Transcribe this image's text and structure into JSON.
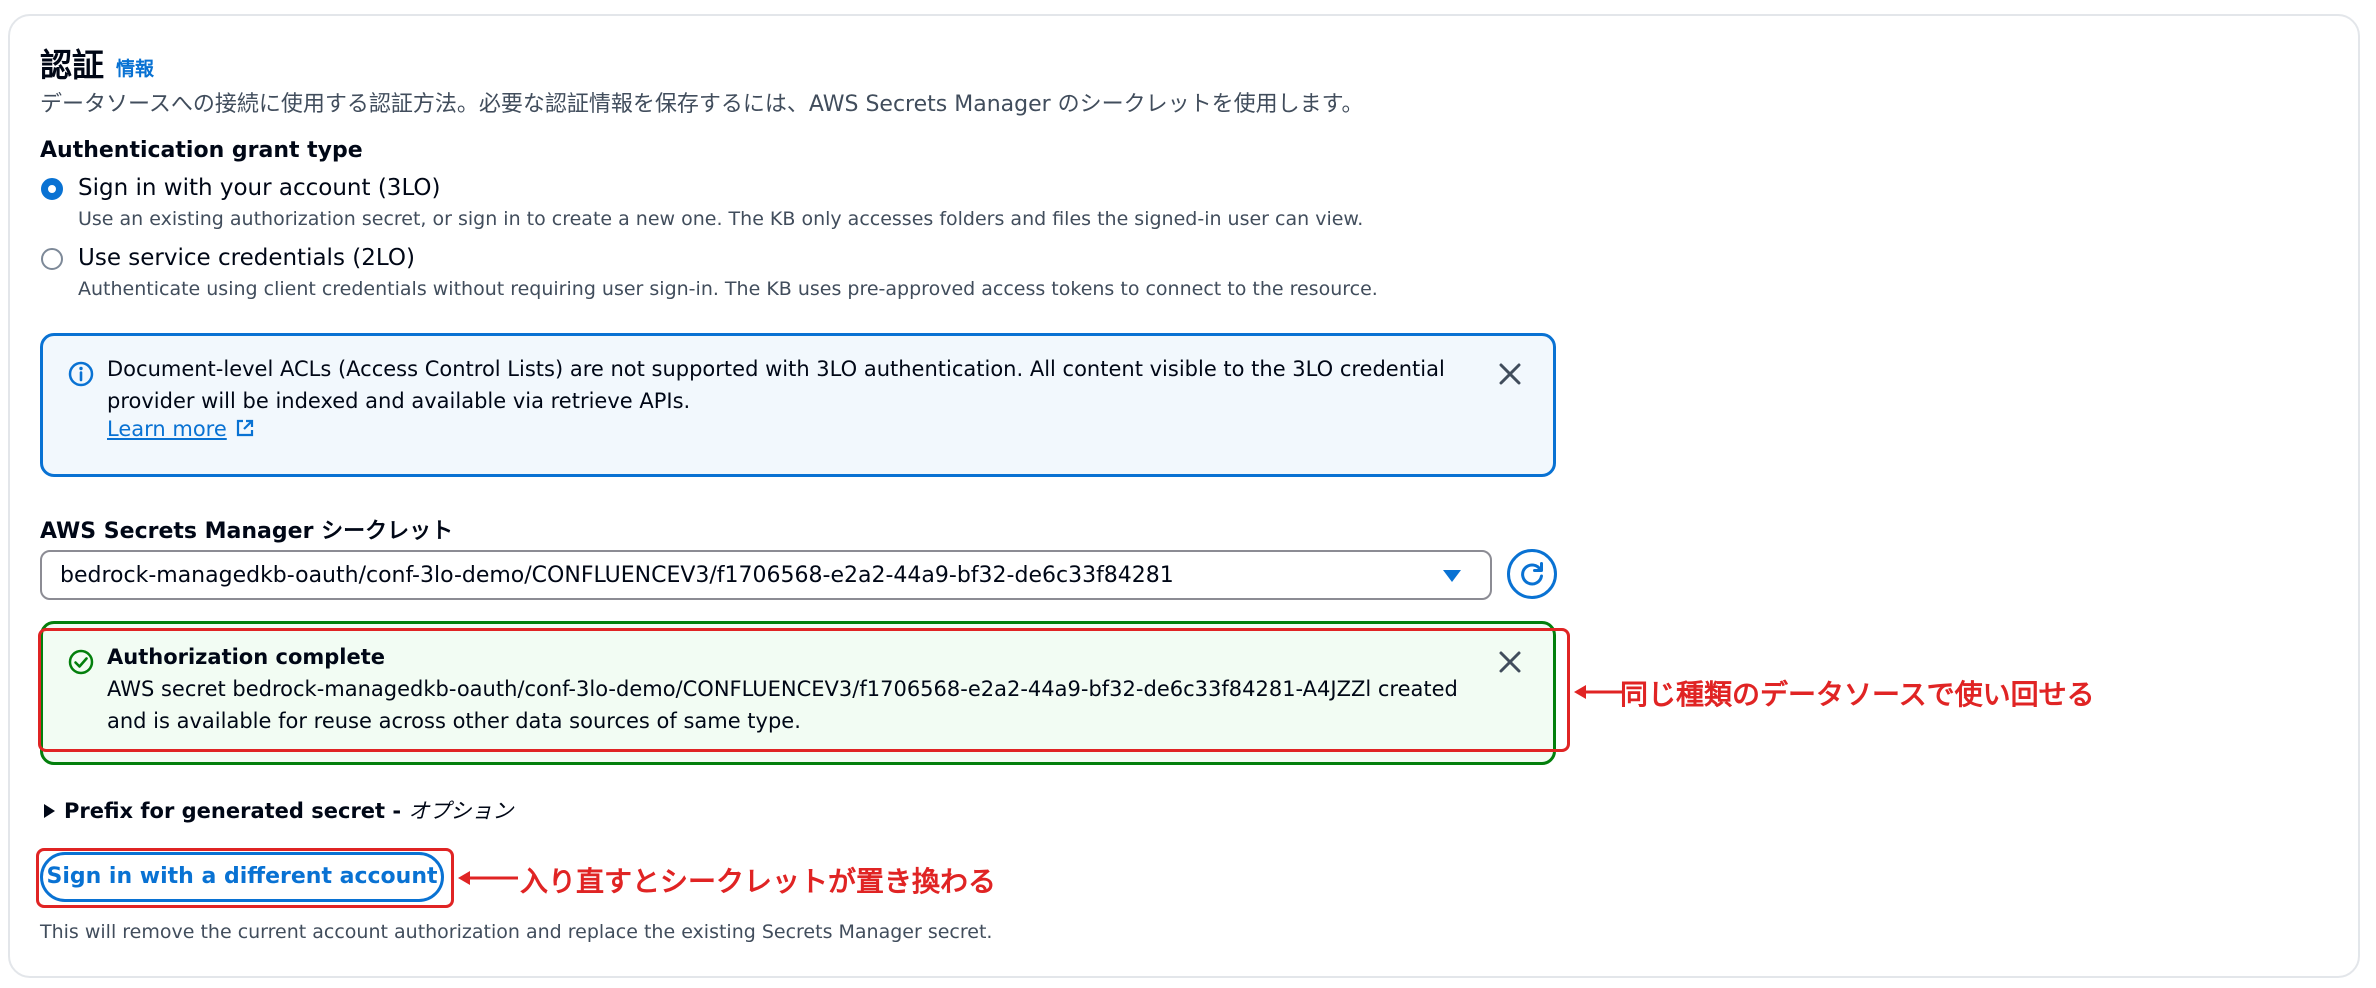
{
  "section": {
    "title": "認証",
    "info_link": "情報",
    "description": "データソースへの接続に使用する認証方法。必要な認証情報を保存するには、AWS Secrets Manager のシークレットを使用します。"
  },
  "grant_type": {
    "label": "Authentication grant type",
    "options": [
      {
        "label": "Sign in with your account (3LO)",
        "description": "Use an existing authorization secret, or sign in to create a new one. The KB only accesses folders and files the signed-in user can view.",
        "selected": true
      },
      {
        "label": "Use service credentials (2LO)",
        "description": "Authenticate using client credentials without requiring user sign-in. The KB uses pre-approved access tokens to connect to the resource.",
        "selected": false
      }
    ]
  },
  "info_alert": {
    "line1": "Document-level ACLs (Access Control Lists) are not supported with 3LO authentication. All content visible to the 3LO credential",
    "line2": "provider will be indexed and available via retrieve APIs.",
    "learn_more": "Learn more",
    "icon": "info-icon"
  },
  "secret_select": {
    "label": "AWS Secrets Manager シークレット",
    "value": "bedrock-managedkb-oauth/conf-3lo-demo/CONFLUENCEV3/f1706568-e2a2-44a9-bf32-de6c33f84281"
  },
  "success_alert": {
    "title": "Authorization complete",
    "line1": "AWS secret bedrock-managedkb-oauth/conf-3lo-demo/CONFLUENCEV3/f1706568-e2a2-44a9-bf32-de6c33f84281-A4JZZl created",
    "line2": "and is available for reuse across other data sources of same type.",
    "icon": "check-circle-icon"
  },
  "prefix_section": {
    "label": "Prefix for generated secret",
    "separator": " - ",
    "optional": "オプション"
  },
  "signin_button": {
    "label": "Sign in with a different account",
    "footnote": "This will remove the current account authorization and replace the existing Secrets Manager secret."
  },
  "annotations": {
    "reuse": "同じ種類のデータソースで使い回せる",
    "replace": "入り直すとシークレットが置き換わる"
  },
  "colors": {
    "accent": "#0972d3",
    "success": "#037f0c",
    "annotation": "#e02424"
  }
}
